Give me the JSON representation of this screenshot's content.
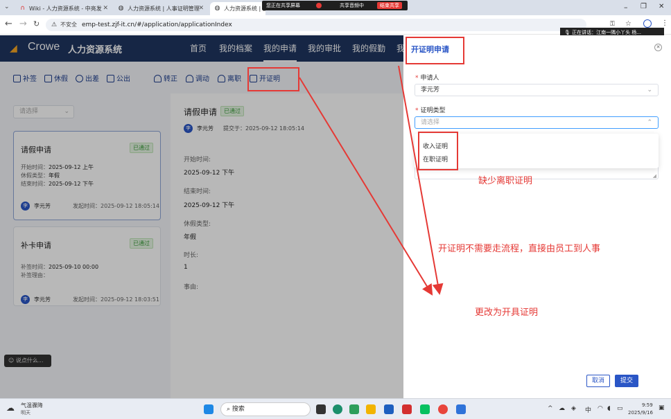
{
  "browser": {
    "tabs": [
      {
        "title": "Wiki - 人力资源系统 - 中亮发"
      },
      {
        "title": "人力资源系统 | 人事证明管理"
      },
      {
        "title": "人力资源系统 | 我的"
      }
    ],
    "sharing_text": "您正在共享屏幕",
    "audio_share": "共享音频中",
    "stop_share": "结束共享",
    "speaking": "正在讲话：江南一隅小丫头 杨...",
    "not_secure": "不安全",
    "url": "emp-test.zjf-it.cn/#/application/applicationIndex"
  },
  "app": {
    "logo": "Crowe",
    "system_name": "人力资源系统",
    "menu": [
      "首页",
      "我的档案",
      "我的申请",
      "我的审批",
      "我的假勤",
      "我"
    ]
  },
  "toolbar": {
    "items": [
      "补签",
      "休假",
      "出差",
      "公出",
      "转正",
      "调动",
      "离职",
      "开证明"
    ]
  },
  "filter": {
    "placeholder": "请选择"
  },
  "cards": [
    {
      "title": "请假申请",
      "status": "已通过",
      "rows": [
        {
          "k": "开始时间：",
          "v": "2025-09-12 上午"
        },
        {
          "k": "休假类型：",
          "v": "年假"
        },
        {
          "k": "结束时间：",
          "v": "2025-09-12 下午"
        }
      ],
      "avatar": "李",
      "user": "李元芳",
      "time": "发起时间：2025-09-12 18:05:14"
    },
    {
      "title": "补卡申请",
      "status": "已通过",
      "rows": [
        {
          "k": "补签时间：",
          "v": "2025-09-10 00:00"
        },
        {
          "k": "补签理由：",
          "v": ""
        }
      ],
      "avatar": "李",
      "user": "李元芳",
      "time": "发起时间：2025-09-12 18:03:51"
    }
  ],
  "detail": {
    "title": "请假申请",
    "status": "已通过",
    "avatar": "李",
    "user": "李元芳",
    "submitted": "提交于：2025-09-12 18:05:14",
    "fields": [
      {
        "k": "开始时间:",
        "v": "2025-09-12 下午"
      },
      {
        "k": "结束时间:",
        "v": "2025-09-12 下午"
      },
      {
        "k": "休假类型:",
        "v": "年假"
      },
      {
        "k": "时长:",
        "v": "1"
      },
      {
        "k": "事由:",
        "v": ""
      }
    ]
  },
  "comment_placeholder": "说点什么...",
  "drawer": {
    "title": "开证明申请",
    "applicant_label": "申请人",
    "applicant_value": "李元芳",
    "type_label": "证明类型",
    "type_placeholder": "请选择",
    "options": [
      "收入证明",
      "在职证明"
    ],
    "cancel": "取消",
    "submit": "提交"
  },
  "annotations": {
    "missing": "缺少离职证明",
    "no_workflow": "开证明不需要走流程，直接由员工到人事",
    "rename": "更改为开具证明"
  },
  "taskbar": {
    "weather": "气温骤降",
    "weather_sub": "明天",
    "search": "搜索",
    "time": "9:59",
    "date": "2025/9/16",
    "ime": "中"
  },
  "colors": {
    "header": "#1f3560",
    "accent": "#2a56c6",
    "annotation": "#e53935",
    "approved": "#3c9d3c"
  }
}
